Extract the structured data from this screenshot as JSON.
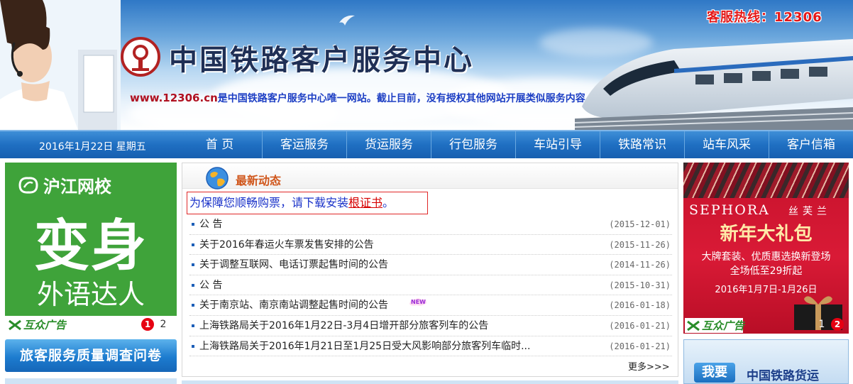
{
  "header": {
    "site_title": "中国铁路客户服务中心",
    "notice_url": "www.12306.cn",
    "notice_text": "是中国铁路客户服务中心唯一网站。截止目前，没有授权其他网站开展类似服务内容，敬请广大用户注意",
    "hotline": "客服热线：12306"
  },
  "nav": {
    "date": "2016年1月22日 星期五",
    "items": [
      "首 页",
      "客运服务",
      "货运服务",
      "行包服务",
      "车站引导",
      "铁路常识",
      "站车风采",
      "客户信箱"
    ]
  },
  "left_ad": {
    "brand": "沪江网校",
    "headline": "变身",
    "subline": "外语达人",
    "sponsor": "互众广告",
    "pager": [
      "1",
      "2"
    ],
    "active_page": "1"
  },
  "survey_button": "旅客服务质量调查问卷",
  "news": {
    "title": "最新动态",
    "cert_notice_prefix": "为保障您顺畅购票，请下载安装",
    "cert_link": "根证书",
    "cert_notice_suffix": "。",
    "items": [
      {
        "title": "公 告",
        "date": "(2015-12-01)",
        "is_new": false
      },
      {
        "title": "关于2016年春运火车票发售安排的公告",
        "date": "(2015-11-26)",
        "is_new": false
      },
      {
        "title": "关于调整互联网、电话订票起售时间的公告",
        "date": "(2014-11-26)",
        "is_new": false
      },
      {
        "title": "公 告",
        "date": "(2015-10-31)",
        "is_new": false
      },
      {
        "title": "关于南京站、南京南站调整起售时间的公告",
        "date": "(2016-01-18)",
        "is_new": true
      },
      {
        "title": "上海铁路局关于2016年1月22日-3月4日增开部分旅客列车的公告",
        "date": "(2016-01-21)",
        "is_new": false
      },
      {
        "title": "上海铁路局关于2016年1月21日至1月25日受大风影响部分旅客列车临时...",
        "date": "(2016-01-21)",
        "is_new": false
      }
    ],
    "more": "更多>>>"
  },
  "right_ad": {
    "brand": "SEPHORA",
    "brand_cn": "丝芙兰",
    "headline": "新年大礼包",
    "line1": "大牌套装、优质惠选换新登场",
    "line2": "全场低至29折起",
    "date_range": "2016年1月7日-1月26日",
    "sponsor": "互众广告",
    "pager": [
      "1",
      "2"
    ],
    "active_page": "2"
  },
  "cargo": {
    "button": "我要",
    "text": "中国铁路货运"
  },
  "colors": {
    "nav_blue": "#1f6fc2",
    "title_orange": "#d0561b",
    "hotline_red": "#e41818",
    "notice_blue": "#1d3fc4",
    "left_ad_green": "#3fa33a",
    "right_ad_red": "#c6122c"
  }
}
